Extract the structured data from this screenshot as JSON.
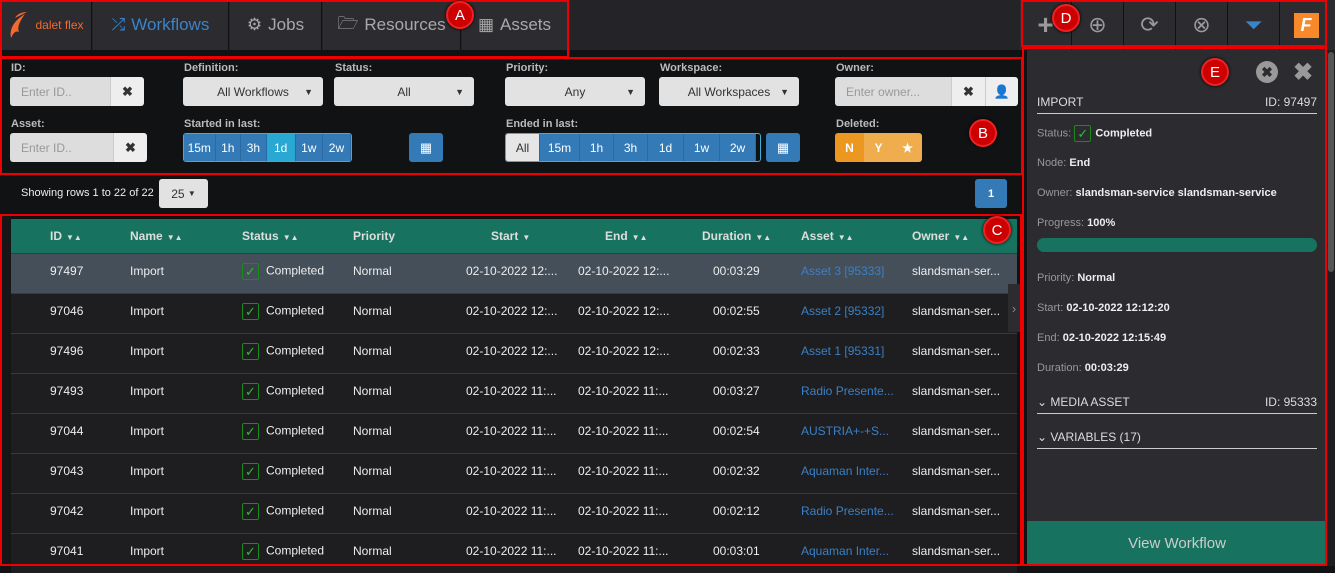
{
  "nav": {
    "logo": "dalet flex",
    "tabs": [
      {
        "label": "Workflows",
        "icon": "shuffle-icon",
        "active": true
      },
      {
        "label": "Jobs",
        "icon": "gear-icon"
      },
      {
        "label": "Resources",
        "icon": "folder-open-icon"
      },
      {
        "label": "Assets",
        "icon": "film-icon"
      }
    ]
  },
  "toolbar": {
    "icons": [
      "plus-icon",
      "download-icon",
      "refresh-icon",
      "cancel-circle-icon",
      "filter-icon",
      "flex-logo-icon"
    ]
  },
  "filters": {
    "id_label": "ID:",
    "id_placeholder": "Enter ID..",
    "definition_label": "Definition:",
    "definition_value": "All Workflows",
    "status_label": "Status:",
    "status_value": "All",
    "priority_label": "Priority:",
    "priority_value": "Any",
    "workspace_label": "Workspace:",
    "workspace_value": "All Workspaces",
    "owner_label": "Owner:",
    "owner_placeholder": "Enter owner...",
    "asset_label": "Asset:",
    "asset_placeholder": "Enter ID..",
    "started_label": "Started in last:",
    "started_options": [
      "15m",
      "1h",
      "3h",
      "1d",
      "1w",
      "2w"
    ],
    "started_selected": "1d",
    "ended_label": "Ended in last:",
    "ended_options": [
      "All",
      "15m",
      "1h",
      "3h",
      "1d",
      "1w",
      "2w"
    ],
    "ended_selected": "All",
    "deleted_label": "Deleted:",
    "deleted_options": [
      "N",
      "Y",
      "★"
    ],
    "deleted_selected": "N"
  },
  "paging": {
    "summary": "Showing rows 1 to 22 of 22",
    "page_size": "25",
    "current_page": "1"
  },
  "table": {
    "columns": [
      "ID",
      "Name",
      "Status",
      "Priority",
      "Start",
      "End",
      "Duration",
      "Asset",
      "Owner"
    ],
    "rows": [
      [
        "97497",
        "Import",
        "Completed",
        "Normal",
        "02-10-2022 12:...",
        "02-10-2022 12:...",
        "00:03:29",
        "Asset 3 [95333]",
        "slandsman-ser..."
      ],
      [
        "97046",
        "Import",
        "Completed",
        "Normal",
        "02-10-2022 12:...",
        "02-10-2022 12:...",
        "00:02:55",
        "Asset 2 [95332]",
        "slandsman-ser..."
      ],
      [
        "97496",
        "Import",
        "Completed",
        "Normal",
        "02-10-2022 12:...",
        "02-10-2022 12:...",
        "00:02:33",
        "Asset 1 [95331]",
        "slandsman-ser..."
      ],
      [
        "97493",
        "Import",
        "Completed",
        "Normal",
        "02-10-2022 11:...",
        "02-10-2022 11:...",
        "00:03:27",
        "Radio Presente...",
        "slandsman-ser..."
      ],
      [
        "97044",
        "Import",
        "Completed",
        "Normal",
        "02-10-2022 11:...",
        "02-10-2022 11:...",
        "00:02:54",
        "AUSTRIA+-+S...",
        "slandsman-ser..."
      ],
      [
        "97043",
        "Import",
        "Completed",
        "Normal",
        "02-10-2022 11:...",
        "02-10-2022 11:...",
        "00:02:32",
        "Aquaman Inter...",
        "slandsman-ser..."
      ],
      [
        "97042",
        "Import",
        "Completed",
        "Normal",
        "02-10-2022 11:...",
        "02-10-2022 11:...",
        "00:02:12",
        "Radio Presente...",
        "slandsman-ser..."
      ],
      [
        "97041",
        "Import",
        "Completed",
        "Normal",
        "02-10-2022 11:...",
        "02-10-2022 11:...",
        "00:03:01",
        "Aquaman Inter...",
        "slandsman-ser..."
      ]
    ]
  },
  "detail": {
    "title": "IMPORT",
    "id": "ID: 97497",
    "status_label": "Status:",
    "status": "Completed",
    "node_label": "Node:",
    "node": "End",
    "owner_label": "Owner:",
    "owner": "slandsman-service slandsman-service",
    "progress_label": "Progress:",
    "progress": "100%",
    "progress_value": 100,
    "priority_label": "Priority:",
    "priority": "Normal",
    "start_label": "Start:",
    "start": "02-10-2022 12:12:20",
    "end_label": "End:",
    "end": "02-10-2022 12:15:49",
    "duration_label": "Duration:",
    "duration": "00:03:29",
    "media_asset": "MEDIA ASSET",
    "media_asset_id": "ID: 95333",
    "variables": "VARIABLES (17)",
    "view_button": "View Workflow"
  },
  "annotations": [
    "A",
    "B",
    "C",
    "D",
    "E"
  ],
  "colors": {
    "accent": "#337ab7",
    "header_green": "#17735f",
    "warning": "#ec971f",
    "brand": "#f7892a"
  }
}
